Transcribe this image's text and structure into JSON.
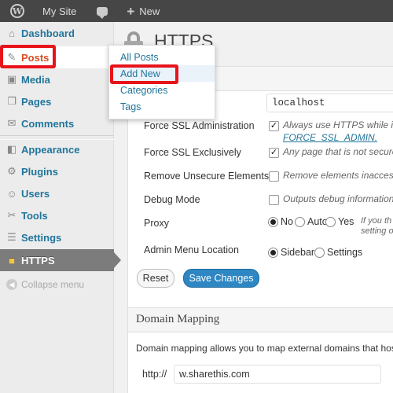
{
  "adminbar": {
    "site_name": "My Site",
    "new_label": "New",
    "logo_letter": "W"
  },
  "sidebar": {
    "items": [
      {
        "label": "Dashboard",
        "icon": "dashboard-icon",
        "glyph": "⌂"
      },
      {
        "label": "Posts",
        "icon": "pushpin-icon",
        "glyph": "✎"
      },
      {
        "label": "Media",
        "icon": "media-icon",
        "glyph": "▣"
      },
      {
        "label": "Pages",
        "icon": "pages-icon",
        "glyph": "❐"
      },
      {
        "label": "Comments",
        "icon": "comments-icon",
        "glyph": "✉"
      },
      {
        "label": "Appearance",
        "icon": "appearance-icon",
        "glyph": "◧"
      },
      {
        "label": "Plugins",
        "icon": "plugins-icon",
        "glyph": "⚙"
      },
      {
        "label": "Users",
        "icon": "users-icon",
        "glyph": "☺"
      },
      {
        "label": "Tools",
        "icon": "tools-icon",
        "glyph": "✂"
      },
      {
        "label": "Settings",
        "icon": "settings-icon",
        "glyph": "☰"
      },
      {
        "label": "HTTPS",
        "icon": "lock-icon",
        "glyph": "🔒"
      }
    ],
    "collapse_label": "Collapse menu"
  },
  "flyout": {
    "items": [
      "All Posts",
      "Add New",
      "Categories",
      "Tags"
    ]
  },
  "page": {
    "title": "HTTPS"
  },
  "settings": {
    "ssl_host_value": "localhost",
    "force_ssl_admin": {
      "label": "Force SSL Administration",
      "checked": true,
      "desc": "Always use HTTPS while in",
      "link": "FORCE_SSL_ADMIN."
    },
    "force_ssl_exclusive": {
      "label": "Force SSL Exclusively",
      "checked": true,
      "desc": "Any page that is not secured"
    },
    "remove_unsecure": {
      "label": "Remove Unsecure Elements",
      "checked": false,
      "desc": "Remove elements inaccess"
    },
    "debug_mode": {
      "label": "Debug Mode",
      "checked": false,
      "desc": "Outputs debug information"
    },
    "proxy": {
      "label": "Proxy",
      "options": [
        "No",
        "Auto",
        "Yes"
      ],
      "selected": "No",
      "desc_line1": "If you th",
      "desc_line2": "setting o"
    },
    "admin_menu_location": {
      "label": "Admin Menu Location",
      "options": [
        "Sidebar",
        "Settings"
      ],
      "selected": "Sidebar"
    },
    "reset_label": "Reset",
    "save_label": "Save Changes"
  },
  "domain_mapping": {
    "title": "Domain Mapping",
    "desc": "Domain mapping allows you to map external domains that host t",
    "prefix": "http://",
    "value": "w.sharethis.com"
  },
  "colors": {
    "highlight_red": "#e8141b",
    "link_blue": "#21759b",
    "primary_button": "#2e87c2",
    "adminbar_bg": "#464646"
  }
}
